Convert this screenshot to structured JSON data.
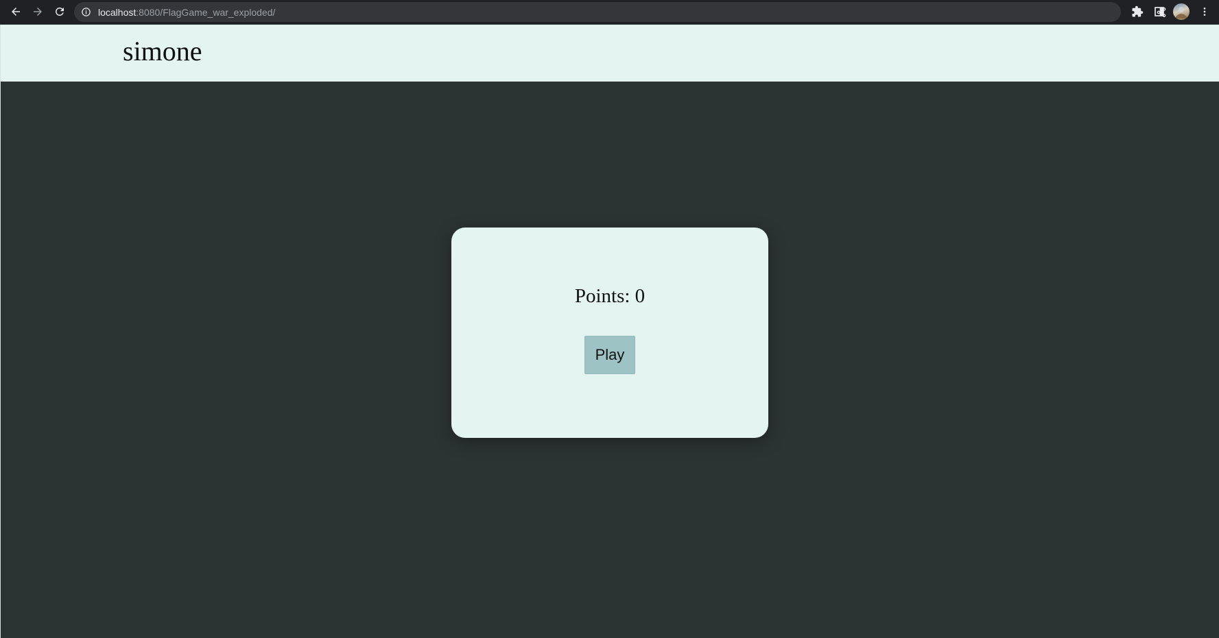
{
  "browser": {
    "url_host": "localhost",
    "url_rest": ":8080/FlagGame_war_exploded/",
    "icons": {
      "back": "arrow-left",
      "forward": "arrow-right",
      "reload": "reload",
      "info": "info-circle",
      "share": "share",
      "bookmark": "star-outline",
      "extensions": "puzzle-piece",
      "side_panel": "side-panel",
      "profile": "avatar",
      "menu": "vertical-dots"
    }
  },
  "header": {
    "username": "simone"
  },
  "card": {
    "points_text": "Points: 0",
    "play_label": "Play"
  },
  "colors": {
    "background": "#2c3433",
    "header_bg": "#e4f4f1",
    "card_bg": "#e4f4f1",
    "button_bg": "#9dc3c4"
  }
}
